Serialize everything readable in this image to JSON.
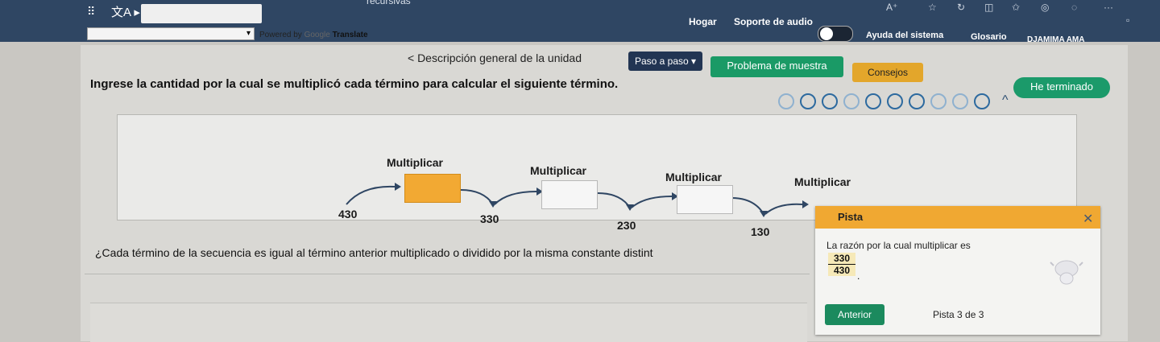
{
  "browser": {
    "tab_title": "recursivas"
  },
  "translate": {
    "select_value": "",
    "powered_by": "Powered by",
    "google": "Google",
    "translate": "Translate"
  },
  "nav": {
    "home": "Hogar",
    "audio": "Soporte de audio",
    "help": "Ayuda del sistema",
    "glossary": "Glosario",
    "user": "DJAMIMA AMA"
  },
  "toolbar": {
    "breadcrumb": "< Descripción general de la unidad",
    "step": "Paso a paso",
    "sample": "Problema de muestra",
    "tips": "Consejos",
    "done": "He terminado"
  },
  "instruction": "Ingrese la cantidad por la cual se multiplicó cada término para calcular el siguiente término.",
  "progress": {
    "total": 10,
    "current": 3
  },
  "diagram": {
    "labels": [
      "Multiplicar",
      "Multiplicar",
      "Multiplicar",
      "Multiplicar"
    ],
    "terms": [
      "430",
      "330",
      "230",
      "130"
    ]
  },
  "question": "¿Cada término de la secuencia es igual al término anterior multiplicado o dividido por la misma constante distint",
  "hint": {
    "title": "Pista",
    "text": "La razón por la cual multiplicar es",
    "numerator": "330",
    "denominator": "430",
    "period": ".",
    "prev": "Anterior",
    "count": "Pista 3 de 3"
  },
  "colors": {
    "topbar": "#2f4663",
    "accent_orange": "#f2a933",
    "green": "#1a9a66"
  }
}
